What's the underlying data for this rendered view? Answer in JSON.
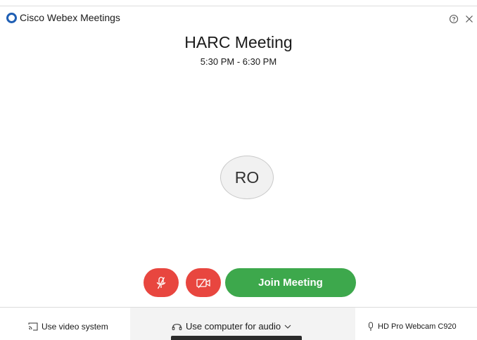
{
  "window": {
    "app_title": "Cisco Webex Meetings",
    "help_icon": "help-icon",
    "close_icon": "close-icon"
  },
  "meeting": {
    "title": "HARC Meeting",
    "time": "5:30 PM - 6:30 PM",
    "avatar_initials": "RO"
  },
  "controls": {
    "mute_icon": "microphone-muted-icon",
    "video_icon": "video-off-icon",
    "join_label": "Join Meeting"
  },
  "bottom_bar": {
    "video_system_label": "Use video system",
    "audio_label": "Use computer for audio",
    "camera_label": "HD Pro Webcam C920"
  },
  "colors": {
    "mute_red": "#e8463f",
    "join_green": "#3da84c",
    "logo_blue": "#1f5fb4"
  }
}
